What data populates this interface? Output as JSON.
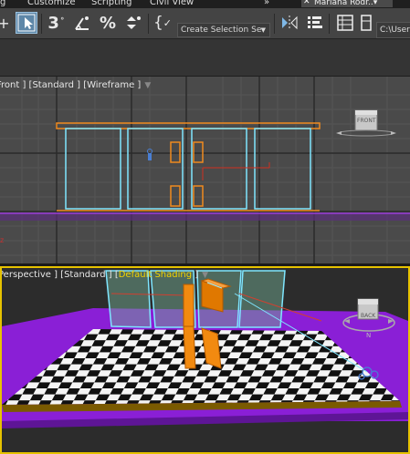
{
  "menu": {
    "items": [
      "g",
      "Customize",
      "Scripting",
      "Civil View",
      "»"
    ],
    "user": "Mariana Rodr..▾"
  },
  "toolbar": {
    "selection_set_placeholder": "Create Selection Se",
    "path_text": "C:\\User"
  },
  "front_viewport": {
    "label_prefix": "Front ] [Standard ] [Wireframe ]",
    "viewcube_face": "FRONT"
  },
  "perspective_viewport": {
    "label_prefix": "Perspective ] [Standard ] [",
    "label_shading": "Default Shading",
    "label_suffix": " ]",
    "viewcube_face": "BACK"
  },
  "colors": {
    "wire_cyan": "#7fe6ff",
    "wire_orange": "#f08a1e",
    "ground_purple": "#8a1fd6",
    "object_orange": "#f28a10",
    "active_border": "#e6c200"
  },
  "icons": [
    "plus-icon",
    "select-object-icon",
    "snap-3d-icon",
    "angle-snap-icon",
    "percent-snap-icon",
    "spinner-snap-icon",
    "curly-brace-icon",
    "mirror-icon",
    "align-icon",
    "layer-explorer-icon"
  ]
}
